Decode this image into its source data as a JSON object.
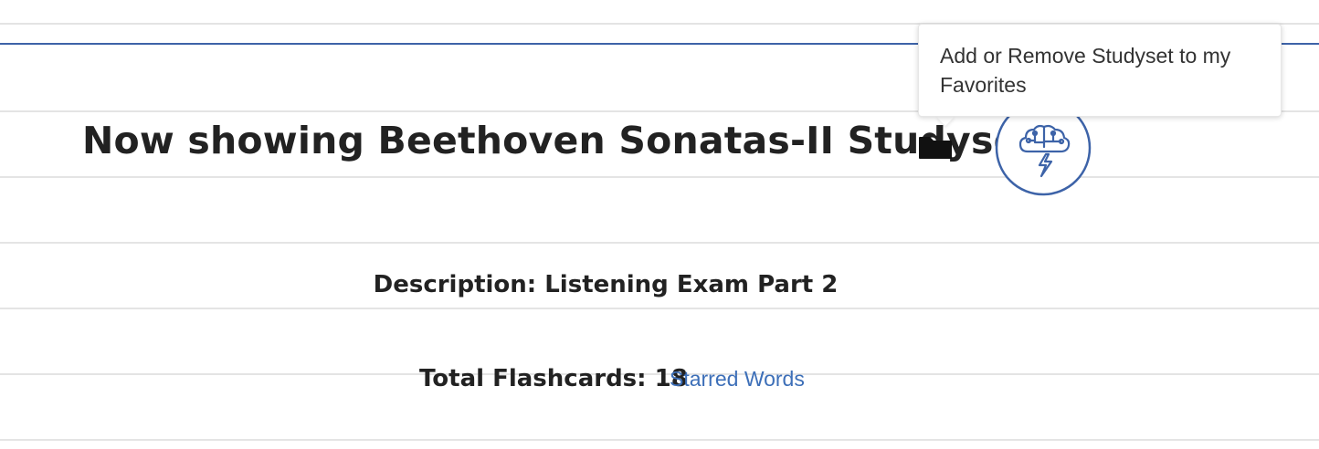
{
  "header": {
    "title": "Now showing Beethoven Sonatas-II Studyset"
  },
  "actions": {
    "folder_icon": "folder-icon",
    "brain_icon": "brain-lightning-icon",
    "accent_color": "#3d63a8"
  },
  "tooltip": {
    "text": "Add or Remove Studyset to my Favorites"
  },
  "details": {
    "description": "Description: Listening Exam Part 2",
    "total_flashcards": "Total Flashcards: 18",
    "starred_link": "Starred Words"
  }
}
